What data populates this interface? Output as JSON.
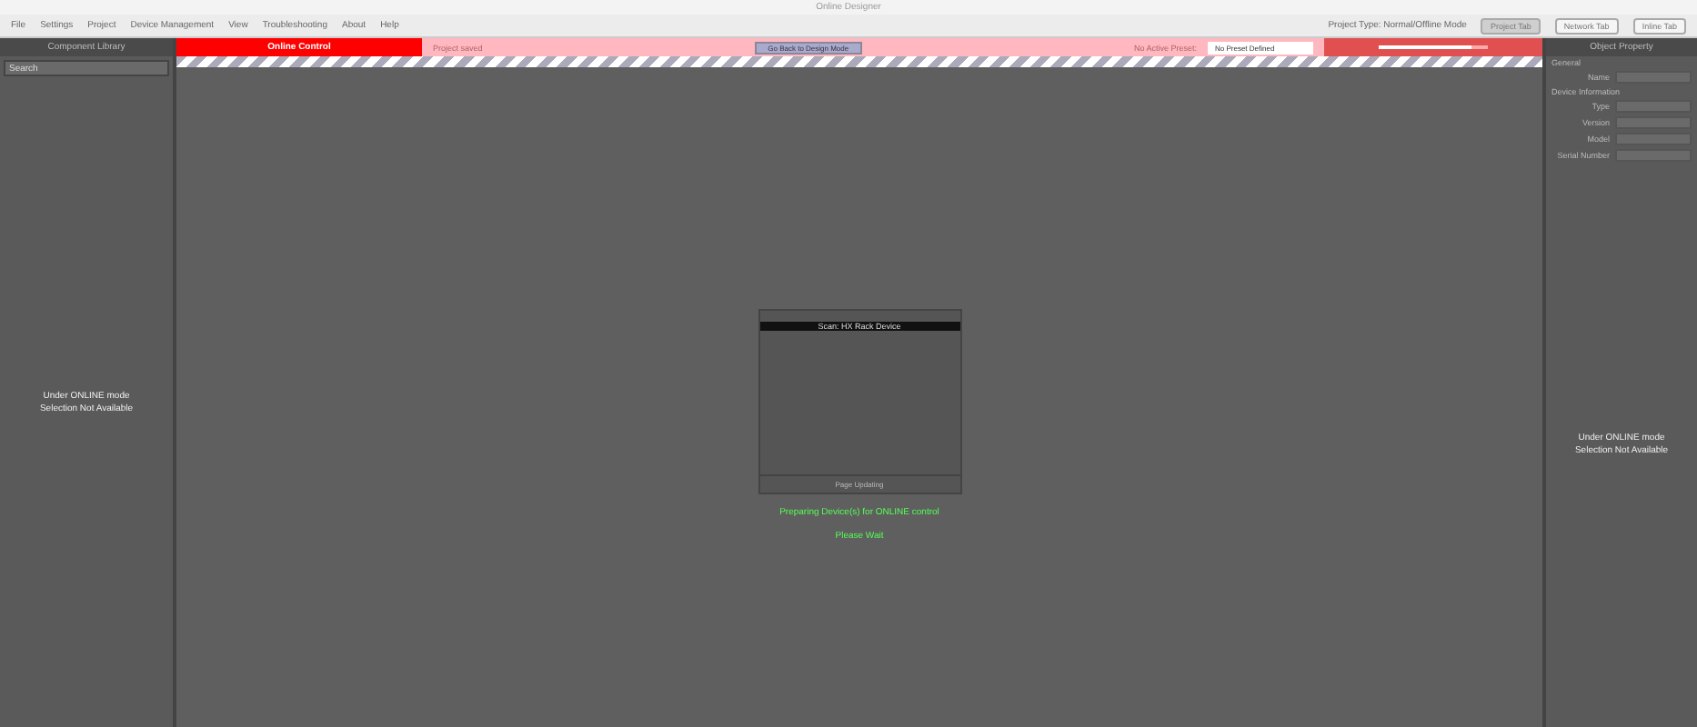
{
  "window": {
    "title": "Online Designer"
  },
  "menu": [
    "File",
    "Settings",
    "Project",
    "Device Management",
    "View",
    "Troubleshooting",
    "About",
    "Help"
  ],
  "project_type": "Project Type: Normal/Offline Mode",
  "right_tabs": [
    {
      "label": "Project Tab",
      "selected": true
    },
    {
      "label": "Network Tab",
      "selected": false
    },
    {
      "label": "Inline Tab",
      "selected": false
    }
  ],
  "left_panel": {
    "title": "Component Library",
    "search": {
      "placeholder": "Search"
    },
    "notice": [
      "Under ONLINE mode",
      "Selection Not Available"
    ]
  },
  "toolbar": {
    "mode": "Online Control",
    "status": "Project saved",
    "back_button": "Go Back to Design Mode",
    "preset_label": "No Active Preset:",
    "preset": "No Preset Defined",
    "level": 0.85
  },
  "dialog": {
    "title": "Scan: HX Rack Device",
    "footer": "Page Updating"
  },
  "messages": [
    "Preparing Device(s) for ONLINE control",
    "Please Wait"
  ],
  "right_panel": {
    "title": "Object Property",
    "section_1": "General",
    "fields": [
      "Name"
    ],
    "section_2": "Device Information",
    "info_fields": [
      "Type",
      "Version",
      "Model"
    ],
    "extra_label": "Serial Number",
    "notice": [
      "Under ONLINE mode",
      "Selection Not Available"
    ]
  }
}
